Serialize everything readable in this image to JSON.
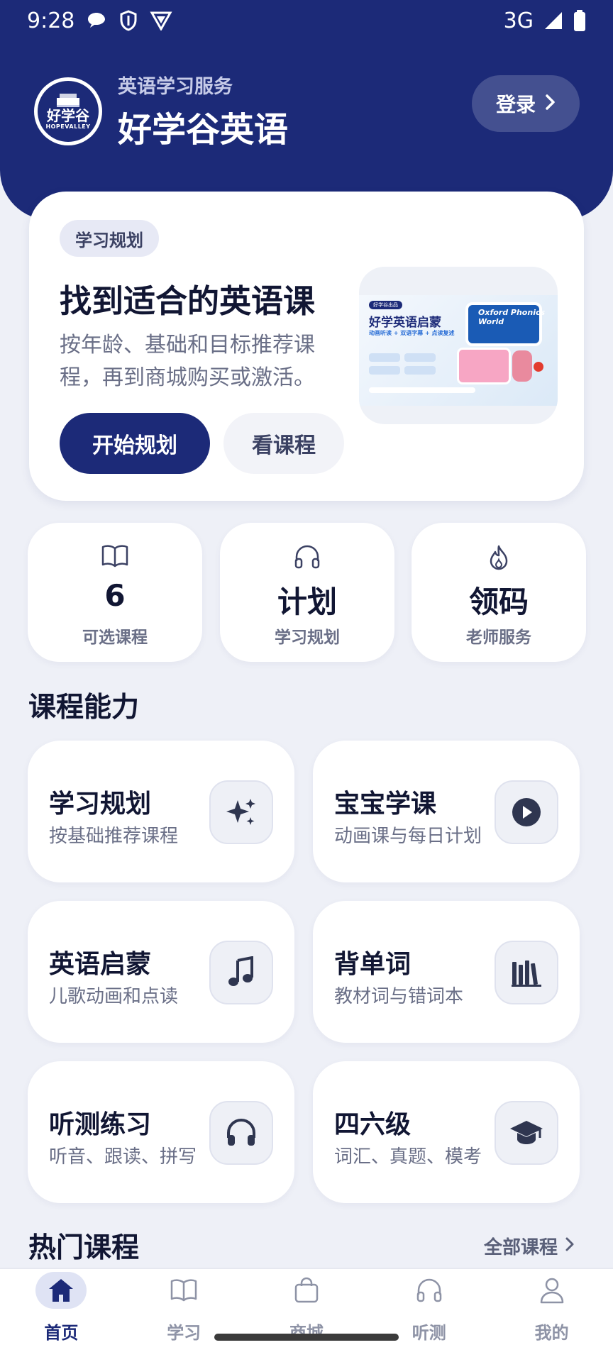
{
  "status_bar": {
    "time": "9:28",
    "network": "3G",
    "left_icons": [
      "chat-bubble-icon",
      "shield-icon",
      "vpn-icon"
    ],
    "right_icons": [
      "signal-icon",
      "battery-icon"
    ]
  },
  "header": {
    "logo_text": "好学谷",
    "logo_subtext": "HOPEVALLEY",
    "subtitle": "英语学习服务",
    "title": "好学谷英语",
    "login_label": "登录"
  },
  "hero": {
    "tag": "学习规划",
    "title": "找到适合的英语课",
    "description": "按年龄、基础和目标推荐课程，再到商城购买或激活。",
    "primary_button": "开始规划",
    "secondary_button": "看课程",
    "thumbnail": {
      "badge": "好学谷出品",
      "title": "好学英语启蒙",
      "subtitle": "动画听读 + 双语字幕 + 点读复述",
      "book_title": "Oxford Phonics World"
    }
  },
  "stats": [
    {
      "icon": "book-icon",
      "value": "6",
      "label": "可选课程"
    },
    {
      "icon": "headphones-icon",
      "value": "计划",
      "label": "学习规划"
    },
    {
      "icon": "flame-icon",
      "value": "领码",
      "label": "老师服务"
    }
  ],
  "section_title": "课程能力",
  "features": [
    {
      "title": "学习规划",
      "subtitle": "按基础推荐课程",
      "icon": "sparkle-icon"
    },
    {
      "title": "宝宝学课",
      "subtitle": "动画课与每日计划",
      "icon": "play-icon"
    },
    {
      "title": "英语启蒙",
      "subtitle": "儿歌动画和点读",
      "icon": "music-note-icon"
    },
    {
      "title": "背单词",
      "subtitle": "教材词与错词本",
      "icon": "library-icon"
    },
    {
      "title": "听测练习",
      "subtitle": "听音、跟读、拼写",
      "icon": "headphones-icon"
    },
    {
      "title": "四六级",
      "subtitle": "词汇、真题、模考",
      "icon": "graduation-cap-icon"
    }
  ],
  "hot_courses": {
    "title": "热门课程",
    "link_label": "全部课程"
  },
  "tabs": [
    {
      "label": "首页",
      "icon": "home-icon",
      "active": true
    },
    {
      "label": "学习",
      "icon": "book-icon",
      "active": false
    },
    {
      "label": "商城",
      "icon": "shopping-bag-icon",
      "active": false
    },
    {
      "label": "听测",
      "icon": "headphones-icon",
      "active": false
    },
    {
      "label": "我的",
      "icon": "user-icon",
      "active": false
    }
  ],
  "colors": {
    "brand": "#1c2a78",
    "background": "#eef0f7",
    "muted_text": "#6a6f87"
  }
}
